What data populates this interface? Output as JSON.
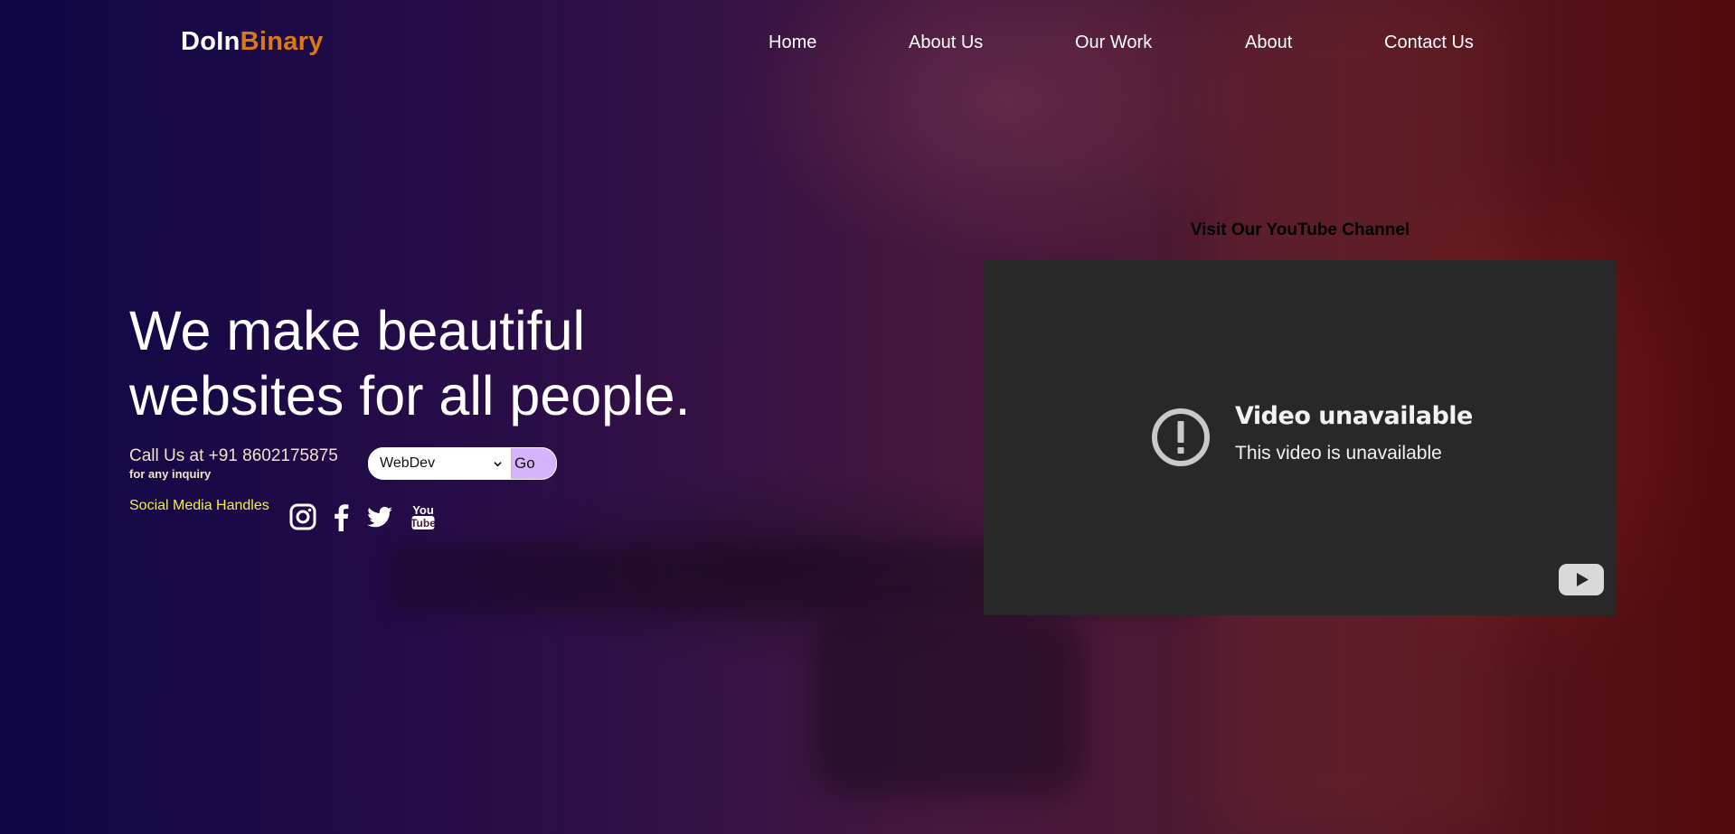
{
  "logo": {
    "part1": "DoIn",
    "part2": "Binary"
  },
  "nav": {
    "items": [
      {
        "label": "Home"
      },
      {
        "label": "About Us"
      },
      {
        "label": "Our Work"
      },
      {
        "label": "About"
      },
      {
        "label": "Contact Us"
      }
    ]
  },
  "hero": {
    "title_line1": "We make beautiful",
    "title_line2": "websites for all people.",
    "call_text": "Call Us at +91 8602175875",
    "call_sub": "for any inquiry",
    "select": {
      "selected": "WebDev",
      "options": [
        "WebDev"
      ]
    },
    "go_label": "Go",
    "social_label": "Social Media Handles",
    "social_icons": [
      "instagram-icon",
      "facebook-icon",
      "twitter-icon",
      "youtube-icon"
    ]
  },
  "video": {
    "heading": "Visit Our YouTube Channel",
    "unavailable_title": "Video unavailable",
    "unavailable_sub": "This video is unavailable",
    "icons": [
      "exclamation-circle-icon",
      "youtube-play-icon"
    ]
  },
  "colors": {
    "logo_accent": "#d97a16",
    "social_label": "#f5ee4a",
    "call_text": "#f3e3c8",
    "go_button": "#d6b3fa",
    "video_bg": "#282828"
  }
}
